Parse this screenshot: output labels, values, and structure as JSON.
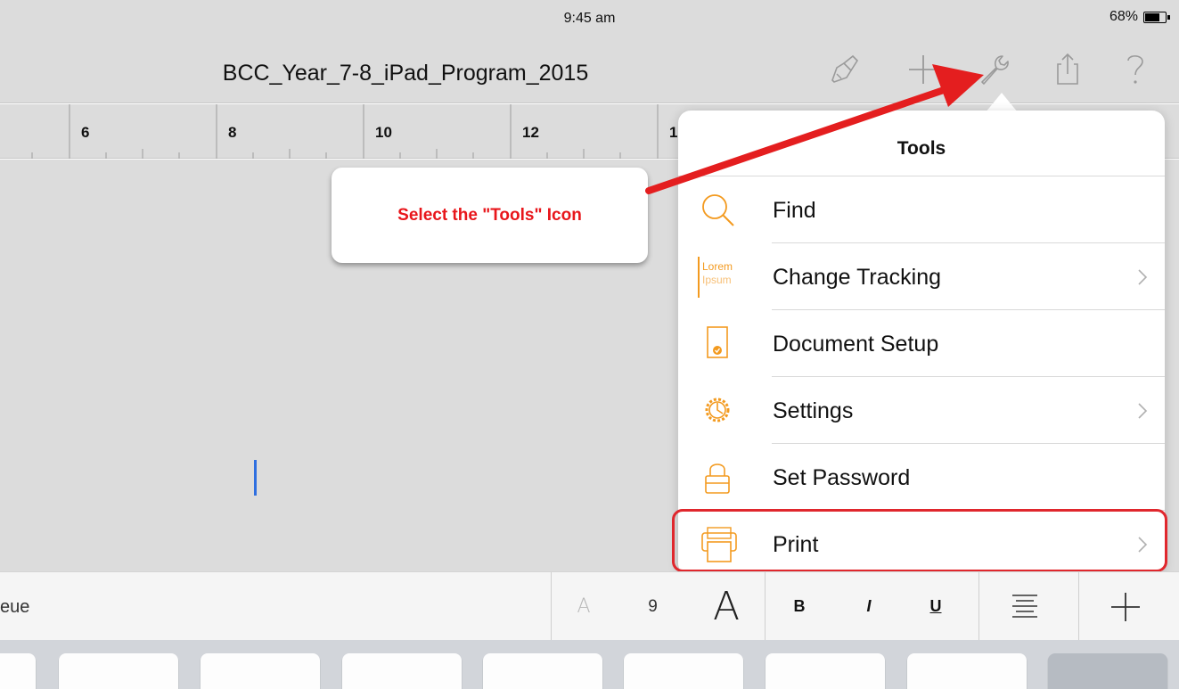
{
  "status_bar": {
    "time": "9:45 am",
    "battery": "68%"
  },
  "document": {
    "title": "BCC_Year_7-8_iPad_Program_2015"
  },
  "toolbar": [
    "paintbrush-icon",
    "plus-icon",
    "wrench-icon",
    "share-icon",
    "help-icon"
  ],
  "ruler": {
    "labels": [
      "6",
      "8",
      "10",
      "12",
      "1"
    ]
  },
  "callout": {
    "text": "Select the \"Tools\" Icon"
  },
  "tools_menu": {
    "title": "Tools",
    "items": [
      {
        "label": "Find",
        "icon": "search-icon",
        "chevron": false
      },
      {
        "label": "Change Tracking",
        "icon": "lorem-ipsum-icon",
        "icon_text": [
          "Lorem",
          "Ipsum"
        ],
        "chevron": true
      },
      {
        "label": "Document Setup",
        "icon": "document-setup-icon",
        "chevron": false
      },
      {
        "label": "Settings",
        "icon": "gear-icon",
        "chevron": true
      },
      {
        "label": "Set Password",
        "icon": "lock-icon",
        "chevron": false
      },
      {
        "label": "Print",
        "icon": "printer-icon",
        "chevron": true
      }
    ]
  },
  "format_bar": {
    "font_name": "eue",
    "decrease_font_label": "A",
    "font_size": "9",
    "increase_font_label": "A",
    "bold_label": "B",
    "italic_label": "I",
    "underline_label": "U"
  },
  "colors": {
    "accent": "#f39a1f",
    "annotation": "#e8161b",
    "background": "#dcdcdc"
  }
}
